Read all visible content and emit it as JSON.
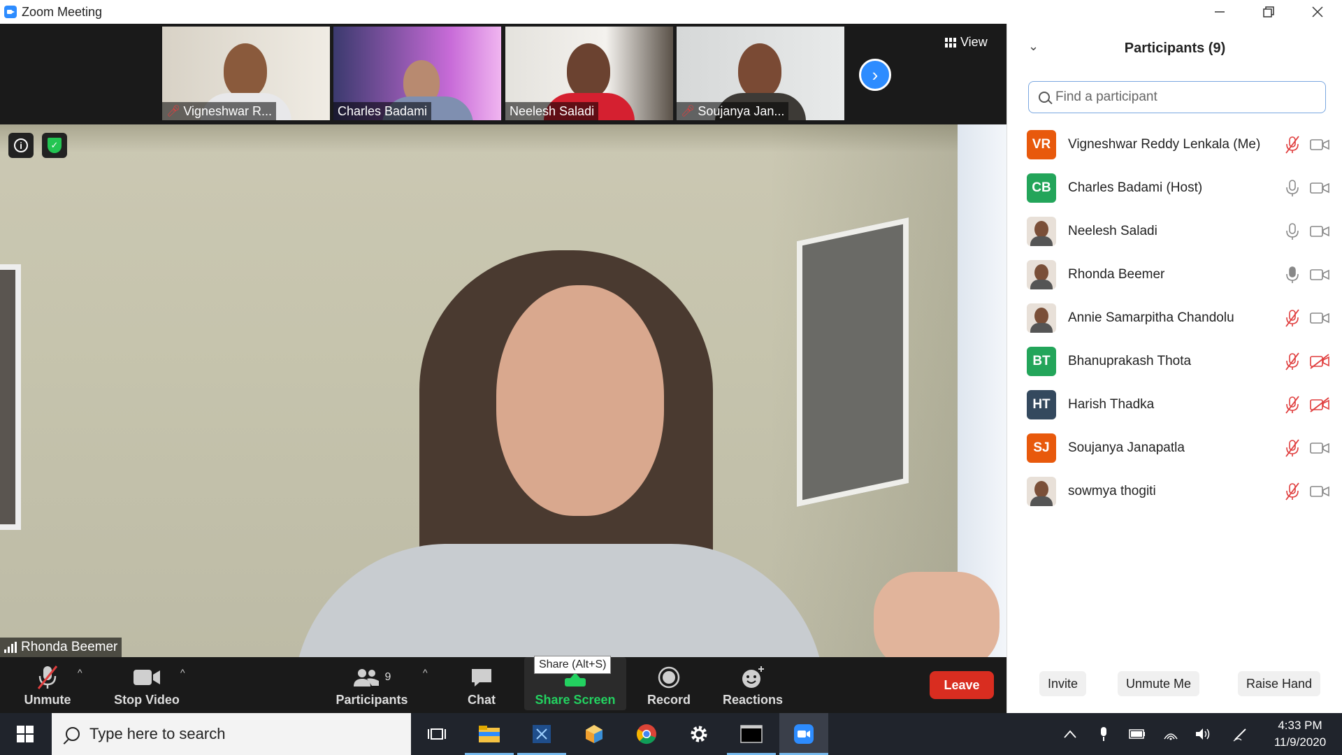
{
  "window": {
    "title": "Zoom Meeting",
    "minimize_icon": "minimize-icon",
    "restore_icon": "restore-icon",
    "close_icon": "close-icon"
  },
  "thumbnails": [
    {
      "name": "Vigneshwar R...",
      "muted": true
    },
    {
      "name": "Charles Badami",
      "muted": false
    },
    {
      "name": "Neelesh Saladi",
      "muted": false
    },
    {
      "name": "Soujanya Jan...",
      "muted": true
    }
  ],
  "view_button": {
    "label": "View"
  },
  "active_speaker": {
    "name": "Rhonda Beemer"
  },
  "toolbar": {
    "unmute_label": "Unmute",
    "stop_video_label": "Stop Video",
    "participants_label": "Participants",
    "participants_count": "9",
    "chat_label": "Chat",
    "share_label": "Share Screen",
    "share_tooltip": "Share (Alt+S)",
    "record_label": "Record",
    "reactions_label": "Reactions",
    "leave_label": "Leave"
  },
  "panel": {
    "title": "Participants (9)",
    "search_placeholder": "Find a participant",
    "participants": [
      {
        "initials": "VR",
        "name": "Vigneshwar Reddy Lenkala (Me)",
        "avatar_color": "#e8590c",
        "mic": "muted",
        "video": "on"
      },
      {
        "initials": "CB",
        "name": "Charles Badami (Host)",
        "avatar_color": "#23a55a",
        "mic": "on",
        "video": "on"
      },
      {
        "initials": "",
        "name": "Neelesh Saladi",
        "avatar_color": "photo",
        "mic": "on",
        "video": "on"
      },
      {
        "initials": "",
        "name": "Rhonda Beemer",
        "avatar_color": "photo",
        "mic": "on-active",
        "video": "on"
      },
      {
        "initials": "",
        "name": "Annie Samarpitha Chandolu",
        "avatar_color": "photo",
        "mic": "muted",
        "video": "on"
      },
      {
        "initials": "BT",
        "name": "Bhanuprakash Thota",
        "avatar_color": "#23a55a",
        "mic": "muted",
        "video": "off"
      },
      {
        "initials": "HT",
        "name": "Harish Thadka",
        "avatar_color": "#34495e",
        "mic": "muted",
        "video": "off"
      },
      {
        "initials": "SJ",
        "name": "Soujanya Janapatla",
        "avatar_color": "#e8590c",
        "mic": "muted",
        "video": "on"
      },
      {
        "initials": "",
        "name": "sowmya thogiti",
        "avatar_color": "photo",
        "mic": "muted",
        "video": "on"
      }
    ],
    "invite_label": "Invite",
    "unmute_me_label": "Unmute Me",
    "raise_hand_label": "Raise Hand"
  },
  "taskbar": {
    "search_placeholder": "Type here to search",
    "apps": [
      "task-view-icon",
      "file-explorer-icon",
      "snipping-tool-icon",
      "3d-viewer-icon",
      "chrome-icon",
      "settings-icon",
      "terminal-icon",
      "zoom-icon"
    ],
    "time": "4:33 PM",
    "date": "11/9/2020"
  },
  "colors": {
    "zoom_blue": "#2d8cff",
    "leave_red": "#d92d20",
    "share_green": "#23d160",
    "muted_red": "#e03e3e",
    "taskbar_bg": "#20242c"
  }
}
